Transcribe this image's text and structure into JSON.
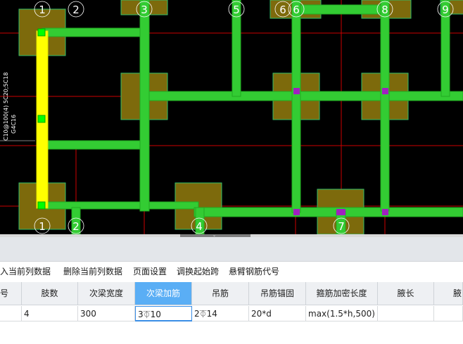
{
  "cad_view": {
    "axis_labels_top": [
      "1",
      "2",
      "3",
      "5",
      "6",
      "6",
      "8",
      "9"
    ],
    "axis_labels_bottom": [
      "1",
      "2",
      "4",
      "7"
    ],
    "beam_annotation_line1": "C10@100(4) 5C20;5C18",
    "beam_annotation_line2": "G4C16",
    "colors": {
      "background": "#000000",
      "beam": "#33cc33",
      "beam_edge": "#22aa22",
      "selected_beam": "#ffff00",
      "column_fill": "#7d6a0c",
      "column_border": "#2fbf6a",
      "axis_line": "#cc0000",
      "marker": "#a020c0",
      "grip": "#00ff00",
      "axis_label": "#ffffff"
    }
  },
  "toolbar": {
    "items": [
      "输入当前列数据",
      "删除当前列数据",
      "页面设置",
      "调换起始跨",
      "悬臂钢筋代号"
    ]
  },
  "grid": {
    "headers": [
      "号",
      "肢数",
      "次梁宽度",
      "次梁加筋",
      "吊筋",
      "吊筋锚固",
      "箍筋加密长度",
      "腋长",
      "腋"
    ],
    "active_header": "次梁加筋",
    "row": {
      "col0": "",
      "legs": "4",
      "width": "300",
      "add_bar_count": "3",
      "add_bar_symbol": "⏁",
      "add_bar_dia": "10",
      "hanger_count": "2",
      "hanger_symbol": "⏁",
      "hanger_dia": "14",
      "anchorage": "20*d",
      "dense_length": "max(1.5*h,500)",
      "haunch_len": "",
      "haunch": ""
    }
  }
}
